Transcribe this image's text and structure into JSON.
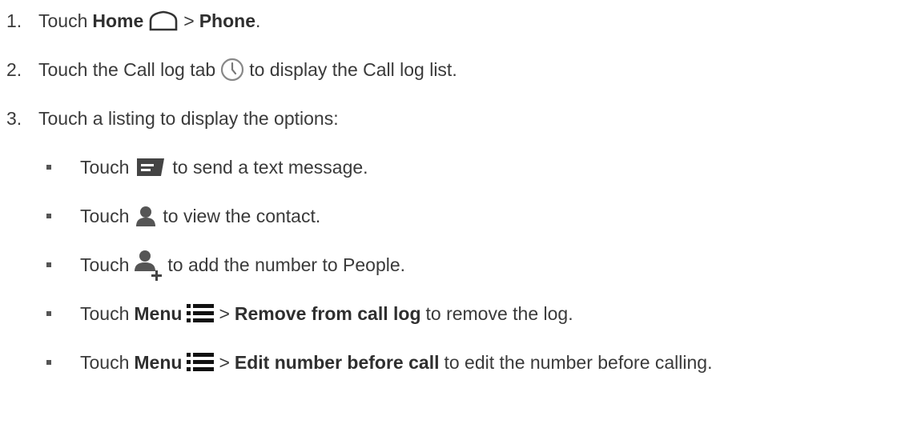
{
  "steps": [
    {
      "number": "1.",
      "text_touch": "Touch",
      "home_label": "Home",
      "separator": ">",
      "phone_label": "Phone",
      "period": ".",
      "icon": "home-icon"
    },
    {
      "number": "2.",
      "text_before": "Touch the Call log tab",
      "text_after": "to display the Call log list.",
      "icon": "clock-icon"
    },
    {
      "number": "3.",
      "text": "Touch a listing to display the options:"
    }
  ],
  "options": [
    {
      "touch": "Touch",
      "icon": "message-icon",
      "text": "to send a text message."
    },
    {
      "touch": "Touch",
      "icon": "contact-icon",
      "text": "to view the contact."
    },
    {
      "touch": "Touch",
      "icon": "add-contact-icon",
      "text": "to add the number to People."
    },
    {
      "touch": "Touch",
      "menu_label": "Menu",
      "icon": "menu-icon",
      "separator": ">",
      "action": "Remove from call log",
      "text": "to remove the log."
    },
    {
      "touch": "Touch",
      "menu_label": "Menu",
      "icon": "menu-icon",
      "separator": ">",
      "action": "Edit number before call",
      "text": "to edit the number before calling."
    }
  ]
}
